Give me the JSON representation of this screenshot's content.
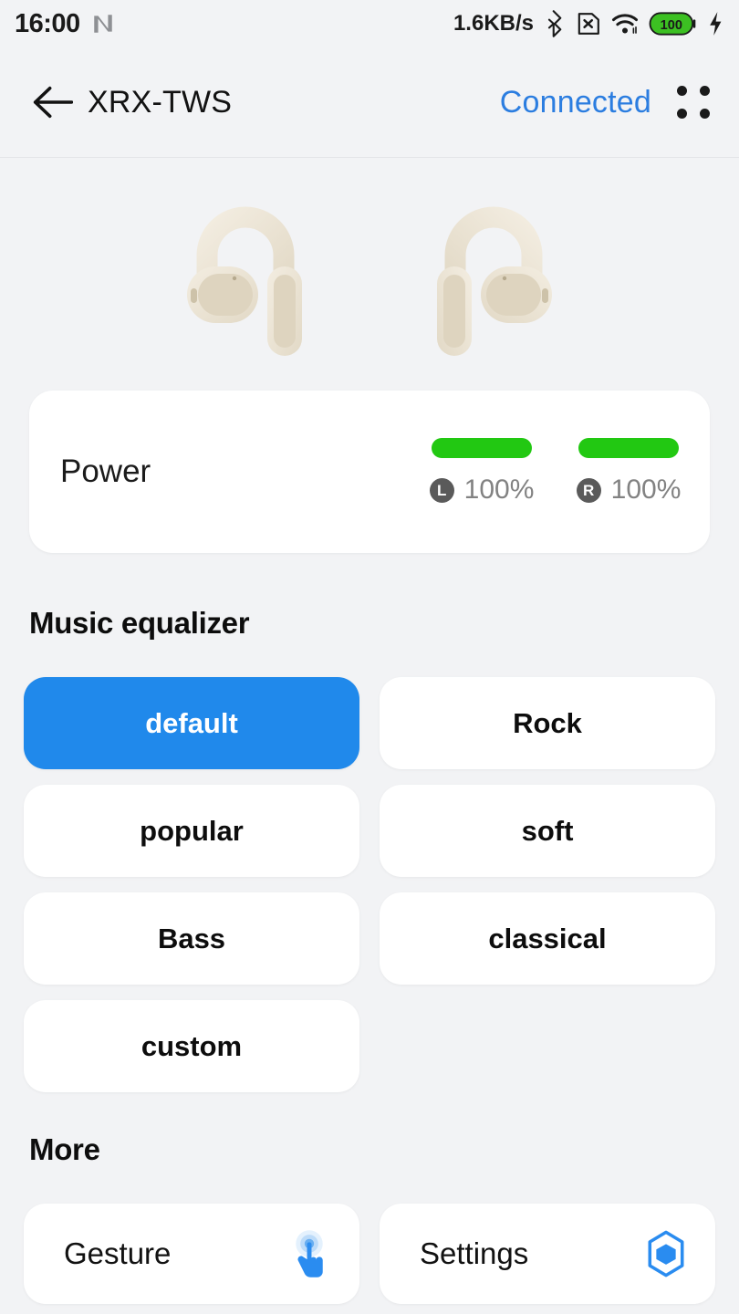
{
  "statusbar": {
    "time": "16:00",
    "nfc_icon": "nfc-icon",
    "network_speed": "1.6KB/s",
    "bluetooth_icon": "bluetooth-icon",
    "sim_icon": "sim-card-off-icon",
    "wifi_icon": "wifi-icon",
    "battery_level": "100",
    "charging_icon": "charging-bolt-icon"
  },
  "header": {
    "back_icon": "back-arrow-icon",
    "title": "XRX-TWS",
    "status": "Connected",
    "menu_icon": "four-dot-menu-icon"
  },
  "device_image": {
    "alt": "open-ear-earbuds-illustration",
    "color": "#efe9dd"
  },
  "power": {
    "label": "Power",
    "bar_color": "#22c812",
    "buds": [
      {
        "side": "L",
        "percent": "100%"
      },
      {
        "side": "R",
        "percent": "100%"
      }
    ]
  },
  "equalizer": {
    "title": "Music equalizer",
    "selected": "default",
    "accent": "#2089eb",
    "options": [
      {
        "label": "default",
        "selected": true
      },
      {
        "label": "Rock",
        "selected": false
      },
      {
        "label": "popular",
        "selected": false
      },
      {
        "label": "soft",
        "selected": false
      },
      {
        "label": "Bass",
        "selected": false
      },
      {
        "label": "classical",
        "selected": false
      },
      {
        "label": "custom",
        "selected": false
      }
    ]
  },
  "more": {
    "title": "More",
    "items": [
      {
        "label": "Gesture",
        "icon": "tap-gesture-icon"
      },
      {
        "label": "Settings",
        "icon": "hexagon-settings-icon"
      }
    ]
  }
}
